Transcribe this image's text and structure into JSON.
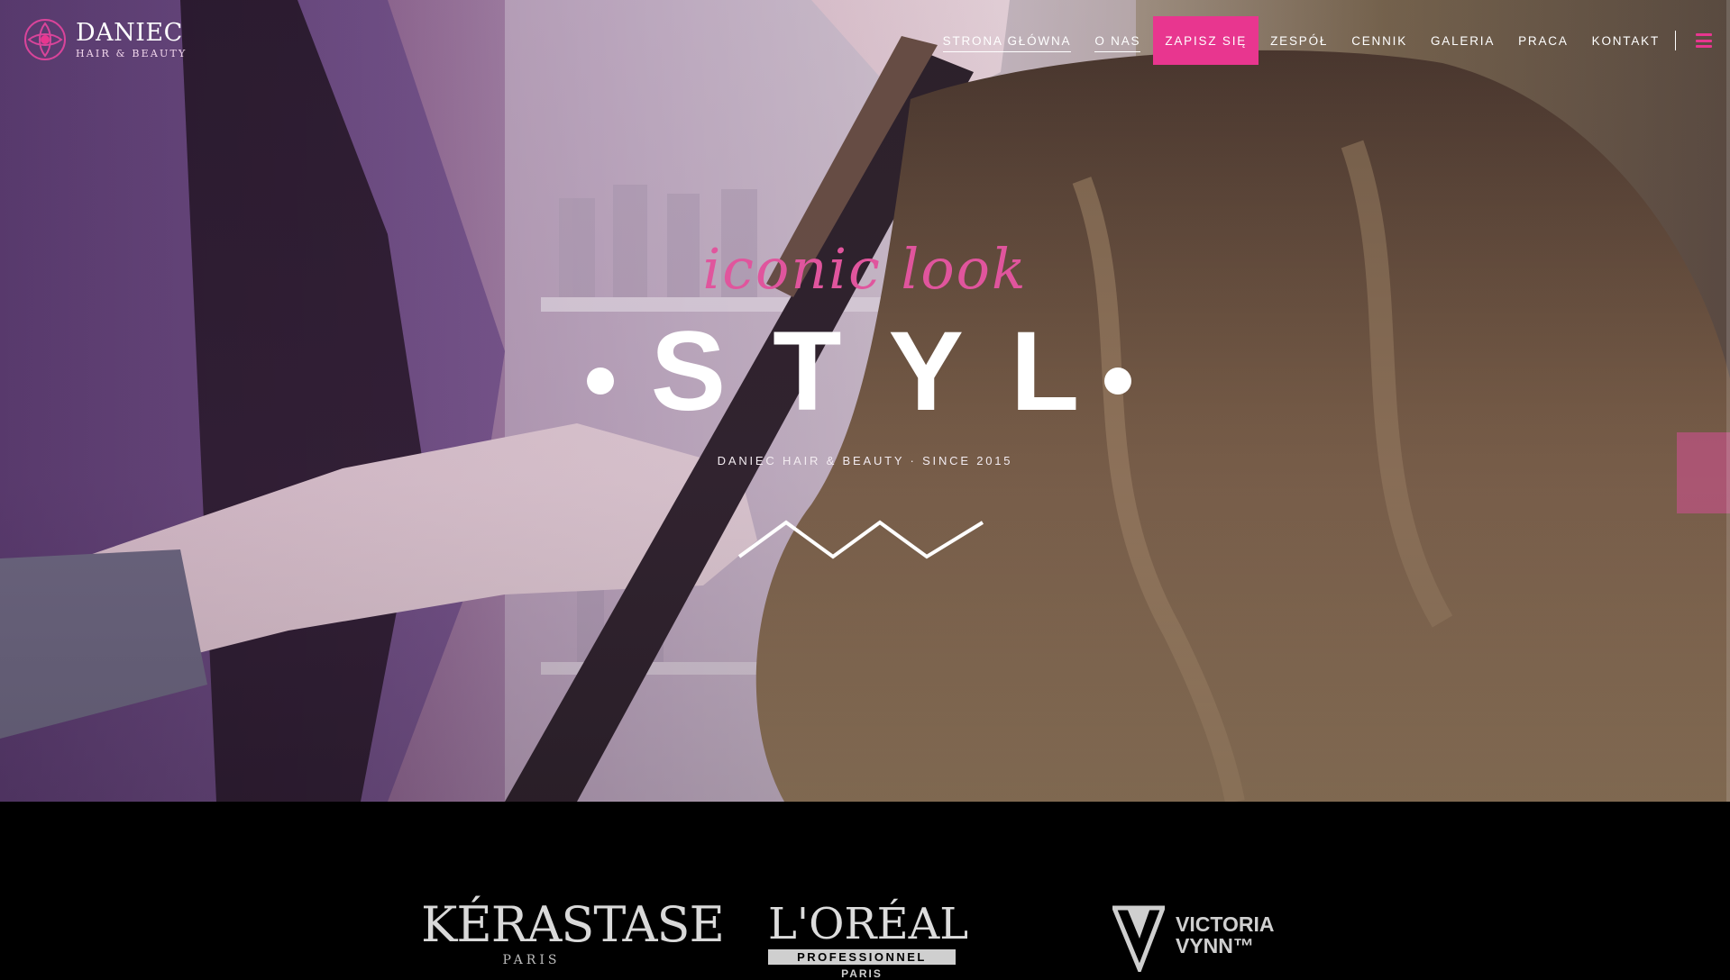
{
  "header": {
    "logo": {
      "name": "DANIEC",
      "subtitle": "HAIR & BEAUTY"
    },
    "nav": [
      {
        "label": "STRONA GŁÓWNA",
        "underlined": true
      },
      {
        "label": "O NAS",
        "underlined": true
      },
      {
        "label": "ZAPISZ SIĘ",
        "cta": true
      },
      {
        "label": "ZESPÓŁ"
      },
      {
        "label": "CENNIK"
      },
      {
        "label": "GALERIA"
      },
      {
        "label": "PRACA"
      },
      {
        "label": "KONTAKT"
      }
    ],
    "menu_icon": "hamburger-icon"
  },
  "hero": {
    "script": "iconic look",
    "title": "STYL",
    "tagline": "DANIEC HAIR & BEAUTY · SINCE 2015",
    "decoration": "zigzag-divider"
  },
  "brands": {
    "kerastase": {
      "name": "KÉRASTASE",
      "sub": "PARIS"
    },
    "loreal": {
      "name": "L'ORÉAL",
      "line": "PROFESSIONNEL",
      "sub": "PARIS"
    },
    "victoria": {
      "name_line1": "VICTORIA",
      "name_line2": "VYNN™"
    }
  },
  "colors": {
    "accent": "#e8368f",
    "script": "#e0559d",
    "footer_bg": "#000000"
  }
}
